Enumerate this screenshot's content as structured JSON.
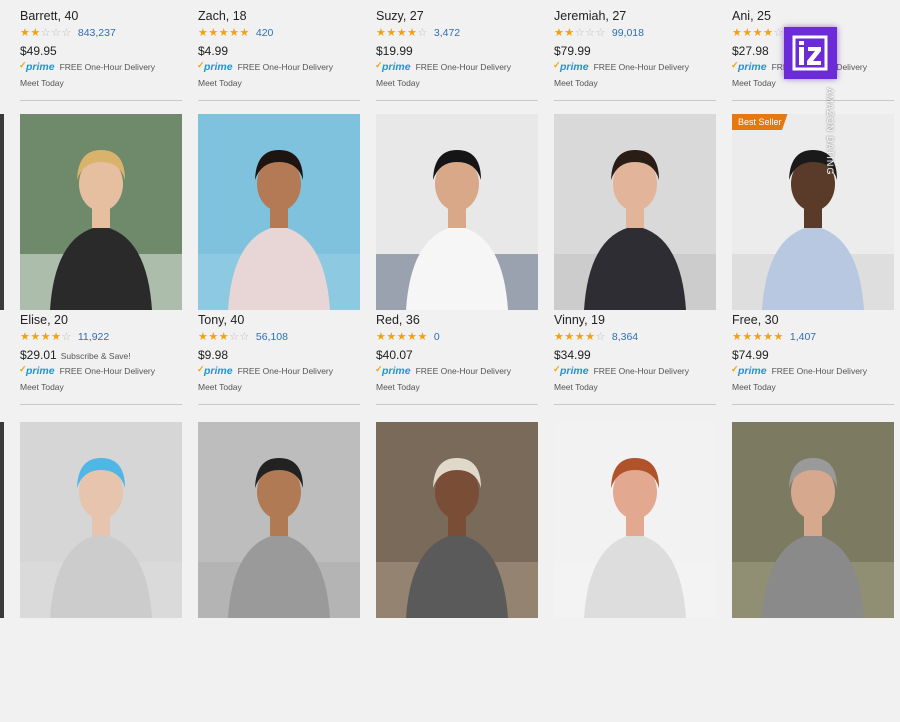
{
  "rows": [
    [
      {
        "name": "Barrett, 40",
        "stars": [
          1,
          1,
          0,
          0,
          0
        ],
        "reviews": "843,237",
        "price": "$49.95",
        "delivery": "FREE One-Hour Delivery",
        "meet": "Meet Today"
      },
      {
        "name": "Zach, 18",
        "stars": [
          1,
          1,
          1,
          1,
          1
        ],
        "reviews": "420",
        "price": "$4.99",
        "delivery": "FREE One-Hour Delivery",
        "meet": "Meet Today"
      },
      {
        "name": "Suzy, 27",
        "stars": [
          1,
          1,
          1,
          1,
          0
        ],
        "reviews": "3,472",
        "price": "$19.99",
        "delivery": "FREE One-Hour Delivery",
        "meet": "Meet Today"
      },
      {
        "name": "Jeremiah, 27",
        "stars": [
          1,
          1,
          0,
          0,
          0
        ],
        "reviews": "99,018",
        "price": "$79.99",
        "delivery": "FREE One-Hour Delivery",
        "meet": "Meet Today"
      },
      {
        "name": "Ani, 25",
        "stars": [
          1,
          1,
          1,
          1,
          0
        ],
        "reviews": "",
        "price": "$27.98",
        "delivery": "FREE One-Hour Delivery",
        "meet": "Meet Today"
      }
    ],
    [
      {
        "name": "Elise, 20",
        "stars": [
          1,
          1,
          1,
          0.5,
          0
        ],
        "reviews": "11,922",
        "price": "$29.01",
        "save": "Subscribe & Save!",
        "delivery": "FREE One-Hour Delivery",
        "meet": "Meet Today",
        "photo": {
          "bg": "#6e8a6a",
          "skin": "#e5bfa0",
          "hair": "#d9b36c",
          "shirt": "#2a2a2a",
          "accent": "#fafafa"
        }
      },
      {
        "name": "Tony, 40",
        "stars": [
          1,
          1,
          0.5,
          0,
          0
        ],
        "reviews": "56,108",
        "price": "$9.98",
        "delivery": "FREE One-Hour Delivery",
        "meet": "Meet Today",
        "photo": {
          "bg": "#7fc2dd",
          "skin": "#b47a55",
          "hair": "#1e1410",
          "shirt": "#e8d6d6",
          "accent": "#9fd4e6"
        }
      },
      {
        "name": "Red, 36",
        "stars": [
          1,
          1,
          1,
          1,
          1
        ],
        "reviews": "0",
        "price": "$40.07",
        "delivery": "FREE One-Hour Delivery",
        "meet": "Meet Today",
        "photo": {
          "bg": "#e8e8e8",
          "skin": "#d8a888",
          "hair": "#151515",
          "shirt": "#f6f6f6",
          "accent": "#3b4c6b"
        }
      },
      {
        "name": "Vinny, 19",
        "stars": [
          1,
          1,
          1,
          1,
          0
        ],
        "reviews": "8,364",
        "price": "$34.99",
        "delivery": "FREE One-Hour Delivery",
        "meet": "Meet Today",
        "photo": {
          "bg": "#d9d9d9",
          "skin": "#e2b49a",
          "hair": "#2a1d16",
          "shirt": "#2d2d33",
          "accent": "#bdbdbd"
        }
      },
      {
        "name": "Free, 30",
        "stars": [
          1,
          1,
          1,
          1,
          0.5
        ],
        "reviews": "1,407",
        "price": "$74.99",
        "delivery": "FREE One-Hour Delivery",
        "meet": "Meet Today",
        "badge": "Best Seller",
        "photo": {
          "bg": "#ececec",
          "skin": "#5a3a28",
          "hair": "#1a1a1a",
          "shirt": "#b8c8e0",
          "accent": "#cfcfcf"
        }
      }
    ],
    [
      {
        "photo": {
          "bg": "#d6d6d6",
          "skin": "#e6c4ad",
          "hair": "#4fb6e6",
          "shirt": "#cccccc",
          "accent": "#e0e0e0"
        }
      },
      {
        "photo": {
          "bg": "#bdbdbd",
          "skin": "#b07a55",
          "hair": "#222222",
          "shirt": "#9a9a9a",
          "accent": "#a8a8a8"
        }
      },
      {
        "photo": {
          "bg": "#7a6a5a",
          "skin": "#7a4e36",
          "hair": "#e0d8c8",
          "shirt": "#5a5a5a",
          "accent": "#b3a28f"
        }
      },
      {
        "photo": {
          "bg": "#f2f2f2",
          "skin": "#e2a890",
          "hair": "#b0532a",
          "shirt": "#dddddd",
          "accent": "#f5f5f5"
        }
      },
      {
        "photo": {
          "bg": "#7d7a62",
          "skin": "#d6a88e",
          "hair": "#9a9a9a",
          "shirt": "#8a8a8a",
          "accent": "#a9a88a"
        }
      }
    ]
  ],
  "prime_label": "prime",
  "logo_text": "iz",
  "watermark": "AMAZON DATING"
}
